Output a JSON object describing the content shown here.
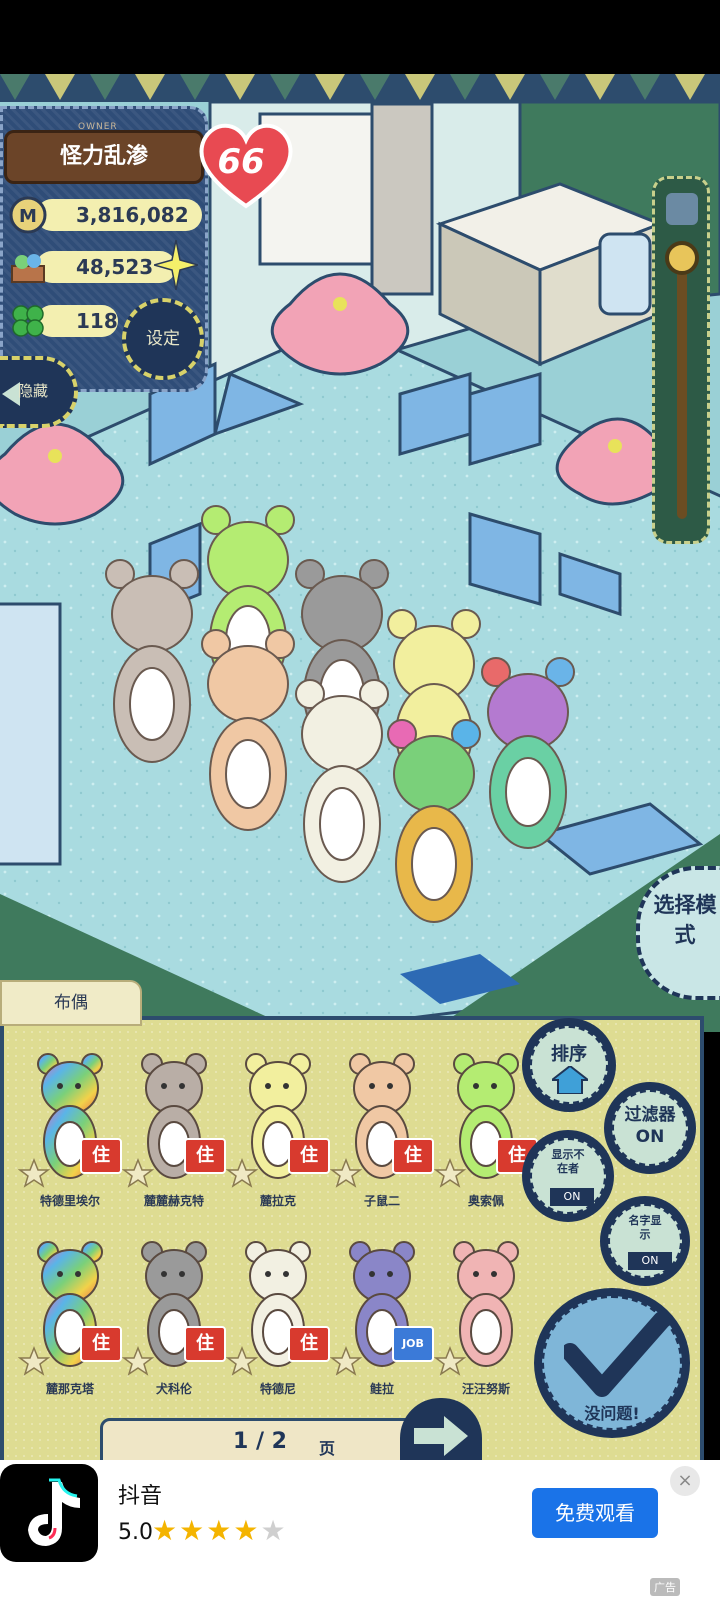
{
  "owner": {
    "tag": "OWNER",
    "name": "怪力乱渗",
    "level": "66"
  },
  "stats": {
    "money": "3,816,082",
    "food": "48,523",
    "clover": "118"
  },
  "buttons": {
    "settings": "设定",
    "hide": "隐藏",
    "select_mode": "选择模式",
    "sort": "排序",
    "filter": "过滤器ON",
    "show_absent": "显示不在者",
    "show_absent_state": "ON",
    "name_display": "名字显示",
    "name_display_state": "ON",
    "confirm": "没问题!"
  },
  "tab": {
    "label": "布偶"
  },
  "dolls": [
    {
      "name": "特德里埃尔",
      "color": "rainbow",
      "badge": "住"
    },
    {
      "name": "麓麓赫克特",
      "color": "#b9aea6",
      "badge": "住"
    },
    {
      "name": "麓拉克",
      "color": "#f2ef9e",
      "badge": "住"
    },
    {
      "name": "子鼠二",
      "color": "#f0c8a4",
      "badge": "住"
    },
    {
      "name": "奥索佩",
      "color": "#b4ec72",
      "badge": "住"
    },
    {
      "name": "麓那克塔",
      "color": "rainbow",
      "badge": "住"
    },
    {
      "name": "犬科伦",
      "color": "#9a9a9a",
      "badge": "住"
    },
    {
      "name": "特德尼",
      "color": "#f2f0e2",
      "badge": "住"
    },
    {
      "name": "鲑拉",
      "color": "#8a86c8",
      "badge": "JOB"
    },
    {
      "name": "汪汪努斯",
      "color": "#f0b4b4",
      "badge": ""
    }
  ],
  "pagination": {
    "current": "1 / 2",
    "suffix": "页"
  },
  "ad": {
    "app_name": "抖音",
    "rating": "5.0",
    "stars_filled": 4,
    "stars_total": 5,
    "cta": "免费观看",
    "close": "×",
    "label": "广告"
  },
  "colors": {
    "panel_navy": "#1f3558",
    "panel_yellow": "#dedc92",
    "floor": "#a9dbe0",
    "badge_red": "#d83a2e",
    "ad_button": "#1a73e8"
  }
}
